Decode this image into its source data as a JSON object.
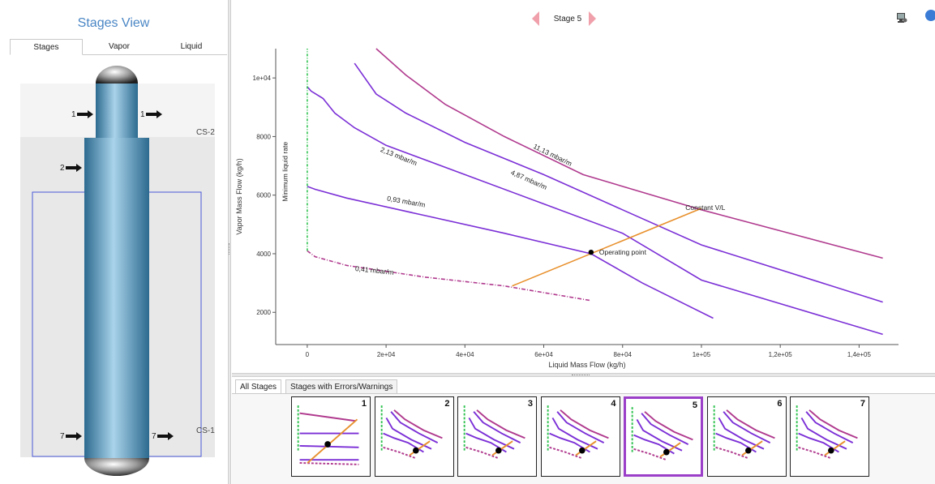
{
  "left_panel": {
    "title": "Stages View",
    "tabs": [
      {
        "label": "Stages",
        "active": true
      },
      {
        "label": "Vapor",
        "active": false
      },
      {
        "label": "Liquid",
        "active": false
      }
    ],
    "sections": [
      "CS-2",
      "CS-1"
    ],
    "streams": [
      {
        "stage": "1",
        "side": "left"
      },
      {
        "stage": "1",
        "side": "right"
      },
      {
        "stage": "2",
        "side": "left"
      },
      {
        "stage": "7",
        "side": "left"
      },
      {
        "stage": "7",
        "side": "right"
      }
    ]
  },
  "header": {
    "stage_label": "Stage 5"
  },
  "icons": {
    "prev": "triangle-left-icon",
    "next": "triangle-right-icon",
    "settings": "monitor-settings-icon",
    "info": "info-icon"
  },
  "colors": {
    "title_blue": "#4a86c5",
    "curve_purple": "#7b2fd6",
    "curve_magenta": "#b03a8e",
    "operating_line": "#e8902c",
    "min_liquid": "#2fc24f",
    "selected_thumb": "#9b3fc9"
  },
  "chart_data": {
    "type": "line",
    "xlabel": "Liquid Mass Flow (kg/h)",
    "ylabel": "Vapor Mass Flow (kg/h)",
    "xlim": [
      -8000,
      150000
    ],
    "ylim": [
      900,
      11000
    ],
    "x_ticks": [
      0,
      20000,
      40000,
      60000,
      80000,
      100000,
      120000,
      140000
    ],
    "x_tick_labels": [
      "0",
      "2e+04",
      "4e+04",
      "6e+04",
      "8e+04",
      "1e+05",
      "1,2e+05",
      "1,4e+05"
    ],
    "y_ticks": [
      2000,
      4000,
      6000,
      8000,
      10000
    ],
    "y_tick_labels": [
      "2000",
      "4000",
      "6000",
      "8000",
      "1e+04"
    ],
    "grid": false,
    "series": [
      {
        "name": "11,13 mbar/m",
        "color": "#b03a8e",
        "dash": false,
        "x": [
          17500,
          25000,
          35000,
          50000,
          70000,
          100000,
          146000
        ],
        "y": [
          11000,
          10100,
          9100,
          8000,
          6700,
          5500,
          3850
        ]
      },
      {
        "name": "4,87 mbar/m",
        "color": "#7b2fd6",
        "dash": false,
        "x": [
          12000,
          17500,
          25000,
          40000,
          60000,
          80000,
          100000,
          146000
        ],
        "y": [
          10500,
          9450,
          8800,
          7800,
          6700,
          5500,
          4300,
          2350
        ]
      },
      {
        "name": "2,13 mbar/m",
        "color": "#7b2fd6",
        "dash": false,
        "x": [
          0,
          1000,
          4000,
          7000,
          12000,
          20000,
          40000,
          60000,
          80000,
          100000,
          146000
        ],
        "y": [
          9700,
          9550,
          9300,
          8800,
          8300,
          7700,
          6700,
          5700,
          4700,
          3100,
          1250
        ]
      },
      {
        "name": "0,93 mbar/m",
        "color": "#7b2fd6",
        "dash": false,
        "x": [
          0,
          2000,
          10000,
          30000,
          50000,
          72000,
          85000,
          103000
        ],
        "y": [
          6300,
          6200,
          5900,
          5300,
          4700,
          4000,
          3000,
          1800
        ]
      },
      {
        "name": "0,41 mbar/m",
        "color": "#b03a8e",
        "dash": true,
        "x": [
          0,
          2000,
          10000,
          30000,
          50000,
          72000
        ],
        "y": [
          4100,
          3900,
          3600,
          3200,
          2900,
          2400
        ]
      },
      {
        "name": "Minimum liquid rate",
        "color": "#2fc24f",
        "dash": true,
        "x": [
          0,
          0
        ],
        "y": [
          4100,
          11000
        ]
      },
      {
        "name": "Constant V/L",
        "color": "#e8902c",
        "dash": false,
        "x": [
          52000,
          100000
        ],
        "y": [
          2900,
          5550
        ]
      }
    ],
    "points": [
      {
        "name": "Operating point",
        "x": 72000,
        "y": 4050
      }
    ]
  },
  "bottom_panel": {
    "tabs": [
      {
        "label": "All Stages",
        "active": true
      },
      {
        "label": "Stages with Errors/Warnings",
        "active": false
      }
    ],
    "thumbnails": [
      {
        "label": "1",
        "selected": false
      },
      {
        "label": "2",
        "selected": false
      },
      {
        "label": "3",
        "selected": false
      },
      {
        "label": "4",
        "selected": false
      },
      {
        "label": "5",
        "selected": true
      },
      {
        "label": "6",
        "selected": false
      },
      {
        "label": "7",
        "selected": false
      }
    ]
  }
}
